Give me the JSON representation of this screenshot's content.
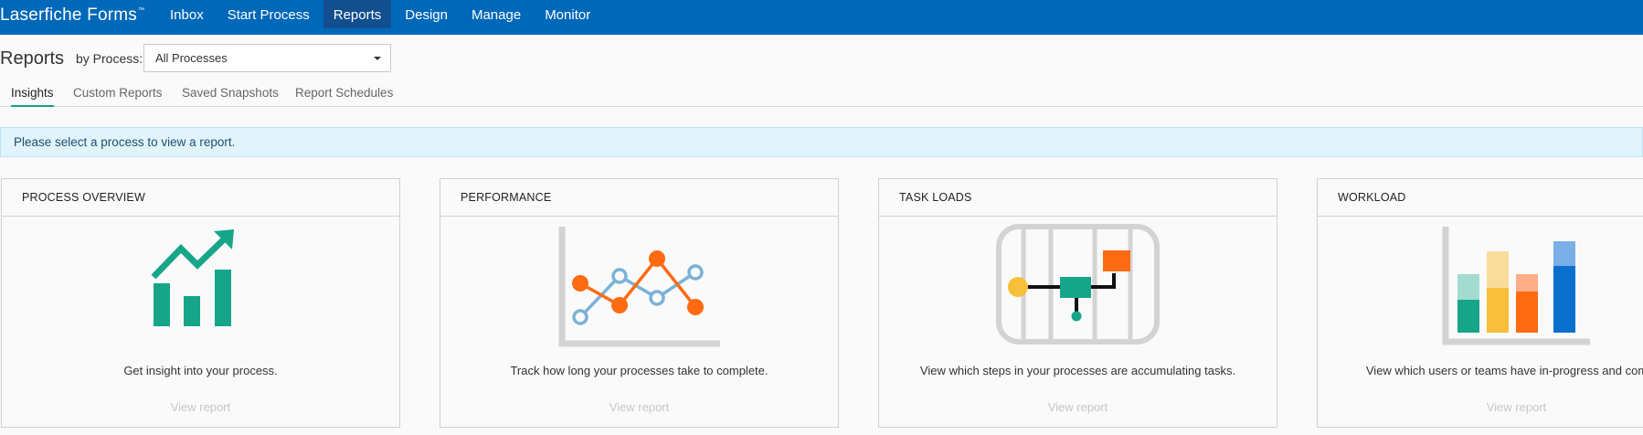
{
  "app": {
    "brand": "Laserfiche Forms",
    "trademark": "™"
  },
  "nav": [
    {
      "label": "Inbox",
      "active": false
    },
    {
      "label": "Start Process",
      "active": false
    },
    {
      "label": "Reports",
      "active": true
    },
    {
      "label": "Design",
      "active": false
    },
    {
      "label": "Manage",
      "active": false
    },
    {
      "label": "Monitor",
      "active": false
    }
  ],
  "page": {
    "title": "Reports",
    "filter_label": "by Process:",
    "filter_value": "All Processes"
  },
  "tabs": [
    {
      "label": "Insights",
      "active": true
    },
    {
      "label": "Custom Reports",
      "active": false
    },
    {
      "label": "Saved Snapshots",
      "active": false
    },
    {
      "label": "Report Schedules",
      "active": false
    }
  ],
  "alert": {
    "text": "Please select a process to view a report."
  },
  "cards": [
    {
      "title": "PROCESS OVERVIEW",
      "description": "Get insight into your process.",
      "link": "View report",
      "icon": "trend-chart-icon"
    },
    {
      "title": "PERFORMANCE",
      "description": "Track how long your processes take to complete.",
      "link": "View report",
      "icon": "line-chart-icon"
    },
    {
      "title": "TASK LOADS",
      "description": "View which steps in your processes are accumulating tasks.",
      "link": "View report",
      "icon": "task-flow-icon"
    },
    {
      "title": "WORKLOAD",
      "description": "View which users or teams have in-progress and complet",
      "link": "View report",
      "icon": "stacked-bar-icon"
    }
  ],
  "colors": {
    "topbar": "#0068b9",
    "active_nav": "#134f8f",
    "teal": "#16a589",
    "orange": "#ff6a13",
    "light_blue": "#7ab2d6",
    "yellow": "#f8bf3a",
    "blue": "#0b6fcd"
  }
}
